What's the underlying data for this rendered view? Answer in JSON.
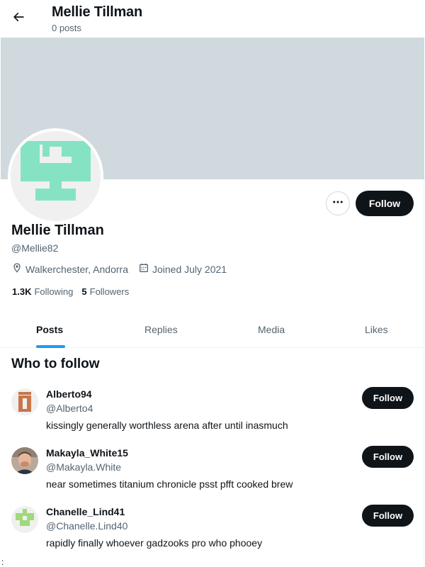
{
  "header": {
    "title": "Mellie Tillman",
    "subtitle": "0 posts",
    "back_icon": "arrow-left-icon"
  },
  "profile": {
    "display_name": "Mellie Tillman",
    "handle": "@Mellie82",
    "location": "Walkerchester, Andorra",
    "joined": "Joined July 2021",
    "following_count": "1.3K",
    "following_label": "Following",
    "followers_count": "5",
    "followers_label": "Followers",
    "follow_label": "Follow",
    "more_icon": "more-horizontal-icon",
    "banner_color": "#cfd9de",
    "avatar_color": "#85e3c4"
  },
  "tabs": [
    {
      "label": "Posts",
      "active": true
    },
    {
      "label": "Replies",
      "active": false
    },
    {
      "label": "Media",
      "active": false
    },
    {
      "label": "Likes",
      "active": false
    }
  ],
  "who_to_follow": {
    "title": "Who to follow",
    "suggestions": [
      {
        "name": "Alberto94",
        "handle": "@Alberto4",
        "bio": "kissingly generally worthless arena after until inasmuch",
        "follow_label": "Follow"
      },
      {
        "name": "Makayla_White15",
        "handle": "@Makayla.White",
        "bio": "near sometimes titanium chronicle psst pfft cooked brew",
        "follow_label": "Follow"
      },
      {
        "name": "Chanelle_Lind41",
        "handle": "@Chanelle.Lind40",
        "bio": "rapidly finally whoever gadzooks pro who phooey",
        "follow_label": "Follow"
      }
    ]
  },
  "colors": {
    "accent": "#1d9bf0",
    "text_primary": "#0f1419",
    "text_secondary": "#536471",
    "button_dark": "#0f1419"
  },
  "stray_mark": ":"
}
